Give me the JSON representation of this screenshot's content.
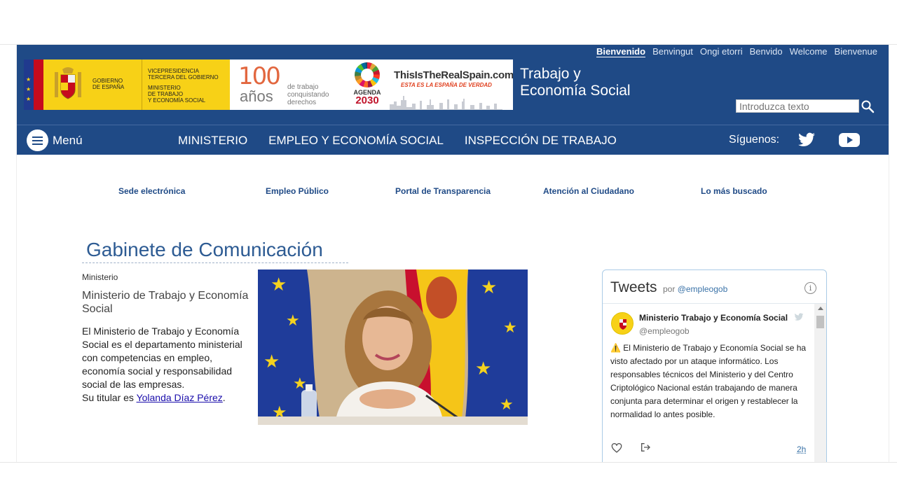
{
  "languages": [
    "Bienvenido",
    "Benvingut",
    "Ongi etorri",
    "Benvido",
    "Welcome",
    "Bienvenue"
  ],
  "logos": {
    "gov_line1": "Gobierno",
    "gov_line2": "de España",
    "vice_line1": "Vicepresidencia",
    "vice_line2": "tercera del gobierno",
    "min_line1": "Ministerio",
    "min_line2": "de trabajo",
    "min_line3": "y economía social",
    "centenary_number": "100",
    "centenary_anos": "años",
    "centenary_line1": "de trabajo",
    "centenary_line2": "conquistando",
    "centenary_line3": "derechos",
    "agenda_label": "AGENDA",
    "agenda_year": "2030",
    "spain_title": "ThisIsTheRealSpain.com",
    "spain_subtitle": "ESTA ES LA ESPAÑA DE VERDAD"
  },
  "site_title_line1": "Trabajo y",
  "site_title_line2": "Economía Social",
  "search": {
    "placeholder": "Introduzca texto"
  },
  "nav": {
    "menu_label": "Menú",
    "links": [
      "MINISTERIO",
      "EMPLEO Y ECONOMÍA SOCIAL",
      "INSPECCIÓN DE TRABAJO"
    ],
    "follow_label": "Síguenos:"
  },
  "quick_links": [
    "Sede electrónica",
    "Empleo Público",
    "Portal de Transparencia",
    "Atención al Ciudadano",
    "Lo más buscado"
  ],
  "main": {
    "title": "Gabinete de Comunicación",
    "section": "Ministerio",
    "org_name": "Ministerio de Trabajo y Economía Social",
    "description": "El Ministerio de Trabajo y Economía Social es el departamento ministerial con competencias en empleo, economía social y responsabilidad social de las empresas.",
    "titular_prefix": "Su titular es ",
    "titular_name": "Yolanda Díaz Pérez",
    "titular_suffix": "."
  },
  "tweets": {
    "title": "Tweets",
    "by_prefix": "por ",
    "by_handle": "@empleogob",
    "author": "Ministerio Trabajo y Economía Social",
    "handle": "@empleogob",
    "warning_icon": "⚠️",
    "text": " El Ministerio de Trabajo y Economía Social se ha visto afectado por un ataque informático. Los responsables técnicos del Ministerio y del Centro Criptológico Nacional están trabajando de manera conjunta para determinar el origen y restablecer la normalidad lo antes posible.",
    "time": "2h"
  },
  "colors": {
    "header_blue": "#1f4a86",
    "title_blue": "#2d5b93",
    "gov_yellow": "#f7d117",
    "link_blue": "#1a0dab"
  }
}
